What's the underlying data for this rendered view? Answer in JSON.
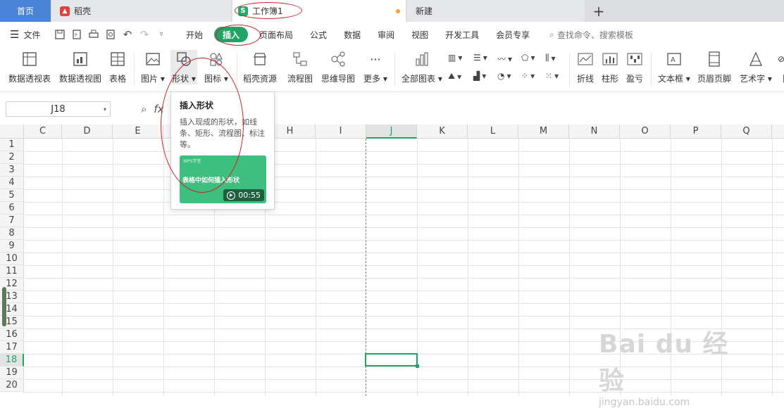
{
  "tabs": {
    "home": "首页",
    "daoke": "稻壳",
    "workbook": "工作簿1",
    "new": "新建",
    "add": "+"
  },
  "menu": {
    "file": "文件",
    "tabs": [
      "开始",
      "插入",
      "页面布局",
      "公式",
      "数据",
      "审阅",
      "视图",
      "开发工具",
      "会员专享"
    ],
    "active_tab": "插入",
    "search": "查找命令、搜索模板"
  },
  "ribbon": {
    "pivot_table": "数据透视表",
    "pivot_chart": "数据透视图",
    "table": "表格",
    "picture": "图片",
    "shape": "形状",
    "icon": "图标",
    "daoke_res": "稻壳资源",
    "flowchart": "流程图",
    "mindmap": "思维导图",
    "more": "更多",
    "all_charts": "全部图表",
    "line": "折线",
    "column": "柱形",
    "winloss": "盈亏",
    "textbox": "文本框",
    "header_footer": "页眉页脚",
    "wordart": "艺术字",
    "partial": "附"
  },
  "formula": {
    "cell_ref": "J18",
    "fx": "fx"
  },
  "sheet": {
    "columns": [
      "C",
      "D",
      "E",
      "F",
      "G",
      "H",
      "I",
      "J",
      "K",
      "L",
      "M",
      "N",
      "O",
      "P",
      "Q"
    ],
    "active_column": "J",
    "rows": [
      "1",
      "2",
      "3",
      "4",
      "5",
      "6",
      "7",
      "8",
      "9",
      "10",
      "11",
      "12",
      "13",
      "14",
      "15",
      "16",
      "17",
      "18",
      "19",
      "20"
    ],
    "active_row": "18"
  },
  "tooltip": {
    "title": "插入形状",
    "desc": "插入现成的形状，如线条、矩形、流程图、标注等。",
    "video_tag": "WPS学堂",
    "video_title": "表格中如何插入形状",
    "duration": "00:55"
  },
  "watermark": {
    "main": "Bai du 经验",
    "sub": "jingyan.baidu.com"
  },
  "colors": {
    "accent": "#21a366",
    "home_tab": "#4a84d6",
    "annotation": "#c8262a"
  }
}
